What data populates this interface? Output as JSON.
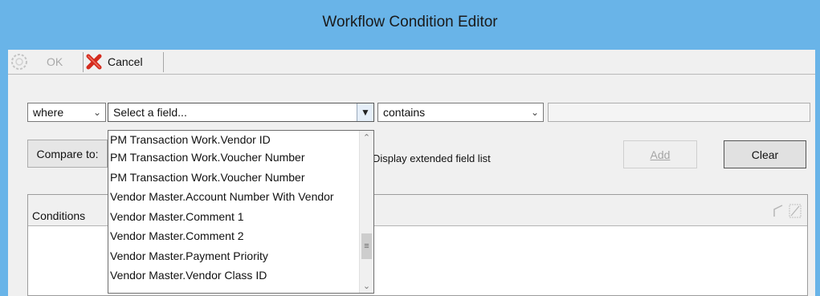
{
  "window": {
    "title": "Workflow Condition Editor"
  },
  "toolbar": {
    "ok_label": "OK",
    "cancel_label": "Cancel"
  },
  "filter": {
    "where_value": "where",
    "field_value": "Select a field...",
    "operator_value": "contains",
    "value_text": ""
  },
  "compare": {
    "compare_label": "Compare to:",
    "extended_label": "Display extended field list",
    "add_label": "Add",
    "clear_label": "Clear"
  },
  "conditions": {
    "header_label": "Conditions"
  },
  "dropdown": {
    "items": [
      "PM Transaction Work.Vendor ID",
      "PM Transaction Work.Voucher Number",
      "PM Transaction Work.Voucher Number",
      "Vendor Master.Account Number With Vendor",
      "Vendor Master.Comment 1",
      "Vendor Master.Comment 2",
      "Vendor Master.Payment Priority",
      "Vendor Master.Vendor Class ID"
    ]
  },
  "colors": {
    "title_bar": "#69b4e8",
    "cancel_icon": "#d42b1e"
  },
  "icons": {
    "ok": "ok-icon",
    "cancel": "cancel-icon",
    "dropdown_arrow": "chevron-down-icon",
    "expand": "expand-icon",
    "resize": "resize-icon"
  }
}
